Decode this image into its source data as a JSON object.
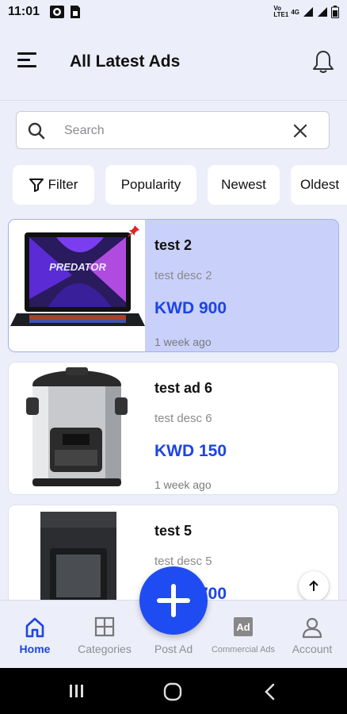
{
  "status_bar": {
    "time": "11:01",
    "network": "Vo LTE1",
    "signal": "4G"
  },
  "header": {
    "title": "All Latest Ads",
    "menu_icon": "menu-icon",
    "bell_icon": "bell-icon"
  },
  "search": {
    "placeholder": "Search",
    "value": ""
  },
  "filters": {
    "filter_label": "Filter",
    "sort_options": [
      "Popularity",
      "Newest",
      "Oldest"
    ]
  },
  "ads": [
    {
      "title": "test 2",
      "description": "test desc 2",
      "price": "KWD 900",
      "posted": "1 week ago",
      "pinned": true,
      "image": "laptop"
    },
    {
      "title": "test ad 6",
      "description": "test desc 6",
      "price": "KWD 150",
      "posted": "1 week ago",
      "pinned": false,
      "image": "pressure-cooker"
    },
    {
      "title": "test 5",
      "description": "test desc 5",
      "price": "KWD 700",
      "posted": "",
      "pinned": false,
      "image": "coffee-maker"
    }
  ],
  "bottom_nav": {
    "items": [
      {
        "label": "Home",
        "icon": "home-icon",
        "active": true
      },
      {
        "label": "Categories",
        "icon": "grid-icon",
        "active": false
      },
      {
        "label": "Post Ad",
        "icon": "plus-icon",
        "active": false
      },
      {
        "label": "Commercial Ads",
        "icon": "ad-icon",
        "active": false
      },
      {
        "label": "Account",
        "icon": "user-icon",
        "active": false
      }
    ]
  },
  "colors": {
    "accent": "#1f4bf2",
    "price": "#1c44e6",
    "highlight": "#c9d1fb",
    "background": "#eceef9"
  }
}
